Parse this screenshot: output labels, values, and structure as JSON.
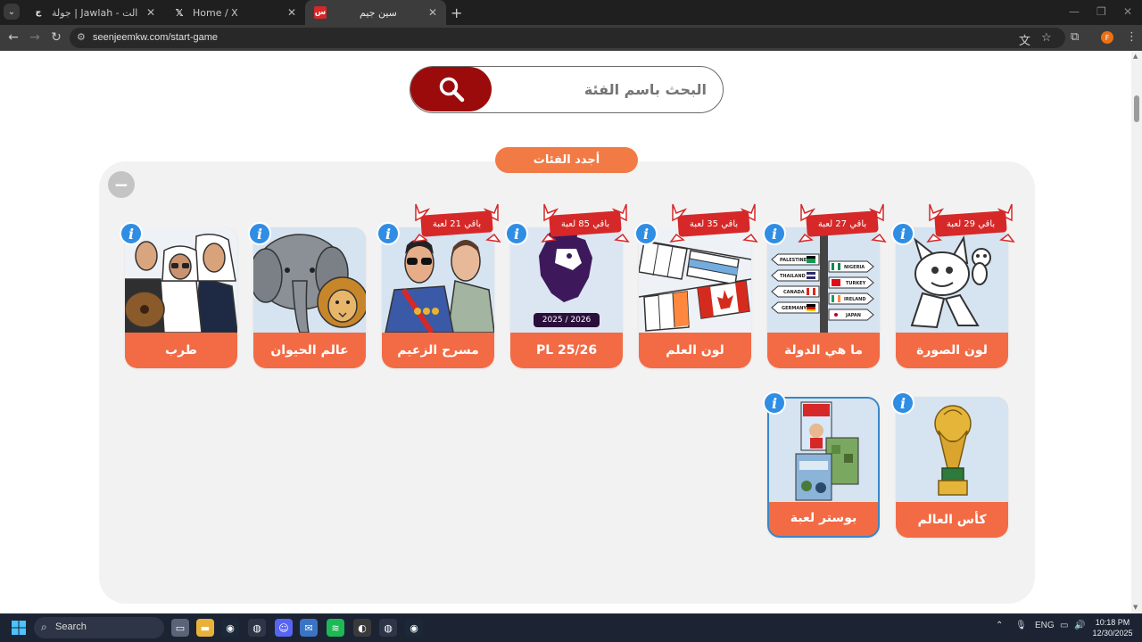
{
  "browser": {
    "tabs": [
      {
        "title": "جولة | Jawlah - منصة الألعاب الت",
        "favicon": "jawlah"
      },
      {
        "title": "Home / X",
        "favicon": "x-logo"
      },
      {
        "title": "سين جيم",
        "favicon": "seenjeem",
        "active": true
      }
    ],
    "new_tab": "+",
    "url": "seenjeemkw.com/start-game",
    "profile_initial": "F"
  },
  "page": {
    "search": {
      "placeholder": "البحث باسم الفئة",
      "icon": "search-icon"
    },
    "section_title": "أجدد الفئات",
    "collapse_symbol": "−",
    "info_symbol": "i",
    "categories": [
      {
        "label": "لون الصورة",
        "badge": "باقي 29 لعبة",
        "image": "cartoon-cat-mouse"
      },
      {
        "label": "ما هي الدولة",
        "badge": "باقي 27 لعبة",
        "image": "signpost-flags",
        "signs": [
          "PALESTINE",
          "THAILAND",
          "CANADA",
          "GERMANY",
          "NIGERIA",
          "TURKEY",
          "IRELAND",
          "JAPAN"
        ]
      },
      {
        "label": "لون العلم",
        "badge": "باقي 35 لعبة",
        "image": "flags-on-string"
      },
      {
        "label": "PL 25/26",
        "badge": "باقي 85 لعبة",
        "image": "premier-league-lion",
        "caption": "2025 / 2026"
      },
      {
        "label": "مسرح الزعيم",
        "badge": "باقي 21 لعبة",
        "image": "theater-characters"
      },
      {
        "label": "عالم الحيوان",
        "badge": "",
        "image": "elephant-lion"
      },
      {
        "label": "طرب",
        "badge": "",
        "image": "musicians"
      },
      {
        "label": "كأس العالم",
        "badge": "",
        "image": "world-cup-trophy"
      },
      {
        "label": "بوستر لعبة",
        "badge": "",
        "image": "game-posters",
        "selected": true
      }
    ]
  },
  "taskbar": {
    "search_label": "Search",
    "language": "ENG",
    "time": "10:18 PM",
    "date": "12/30/2025"
  },
  "colors": {
    "accent": "#f26b45",
    "search_button": "#9b0b0b",
    "info": "#2f8de4",
    "badge": "#d62828"
  }
}
